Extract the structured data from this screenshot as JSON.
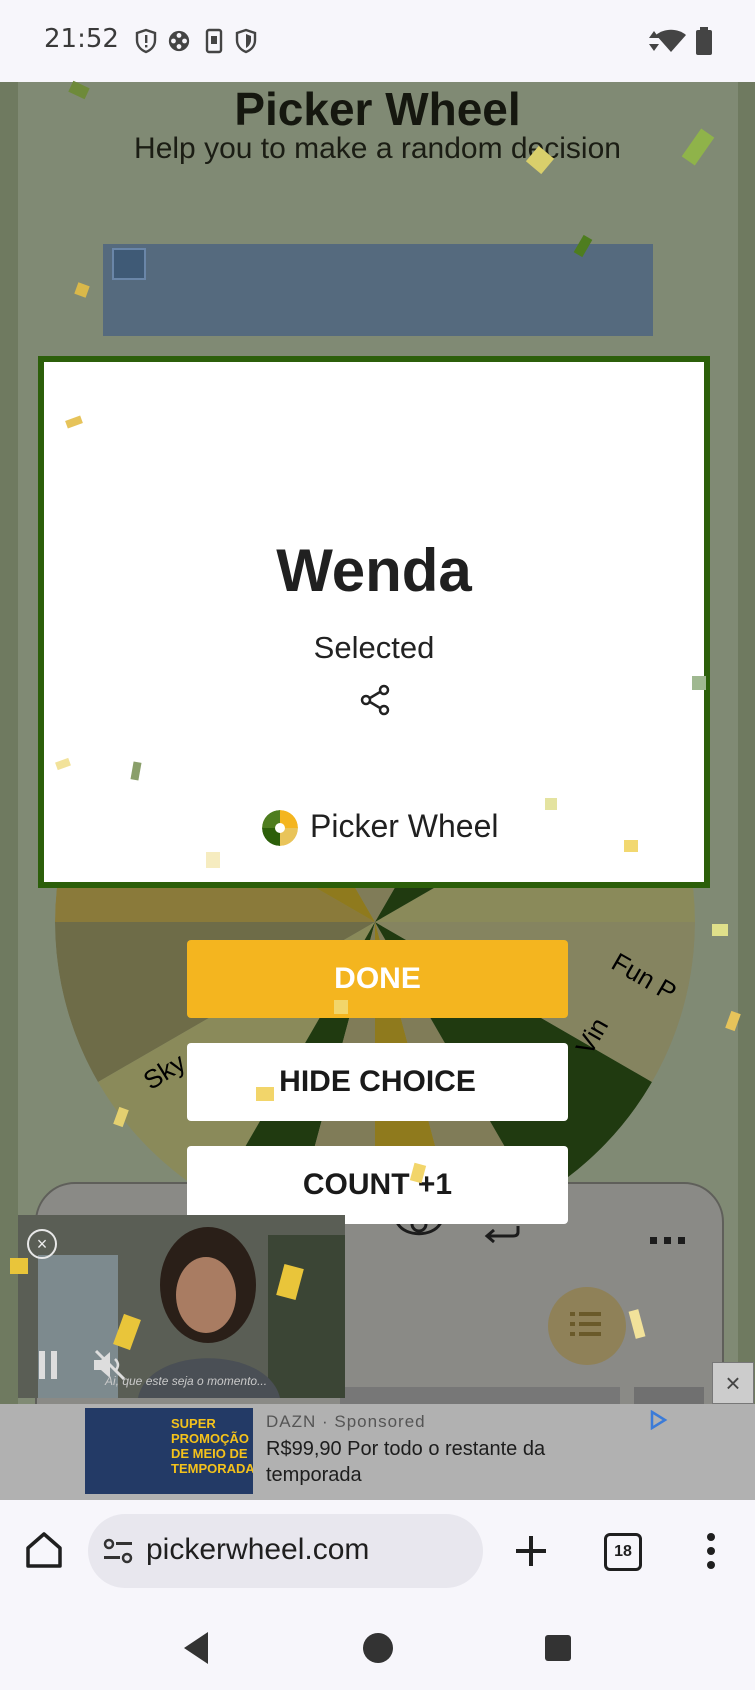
{
  "status_bar": {
    "time": "21:52"
  },
  "page": {
    "title": "Picker Wheel",
    "subtitle": "Help you to make a random decision"
  },
  "wheel": {
    "labels": [
      "Sky",
      "Fun P",
      "Vin"
    ]
  },
  "modal": {
    "result_name": "Wenda",
    "result_status": "Selected",
    "brand": "Picker Wheel"
  },
  "buttons": {
    "done": "DONE",
    "hide_choice": "HIDE CHOICE",
    "count": "COUNT +1"
  },
  "video_ad": {
    "caption": "Ai, que este seja o momento..."
  },
  "bottom_ad": {
    "advertiser": "DAZN",
    "sponsored": "Sponsored",
    "text": "R$99,90 Por todo o restante da temporada",
    "image_text": "SUPER PROMOÇÃO DE MEIO DE TEMPORADA"
  },
  "browser": {
    "url": "pickerwheel.com",
    "tab_count": "18"
  },
  "colors": {
    "accent": "#f4b51f",
    "modal_border": "#2c5f0a"
  }
}
